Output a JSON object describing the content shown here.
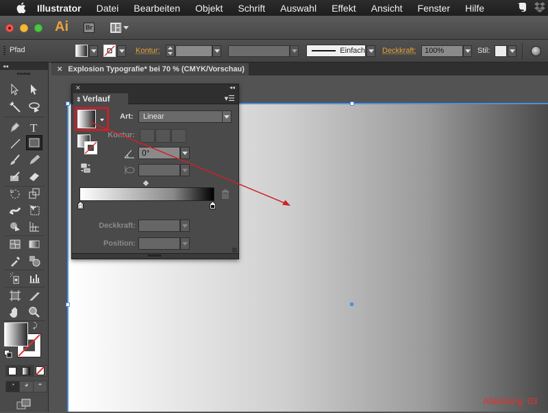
{
  "menubar": {
    "app_name": "Illustrator",
    "items": [
      "Datei",
      "Bearbeiten",
      "Objekt",
      "Schrift",
      "Auswahl",
      "Effekt",
      "Ansicht",
      "Fenster",
      "Hilfe"
    ],
    "tray_icons": [
      "evernote-icon",
      "dropbox-icon"
    ]
  },
  "appbar": {
    "logo": "Ai",
    "bridge_label": "Br"
  },
  "control_bar": {
    "selection_type": "Pfad",
    "stroke_label": "Kontur:",
    "stroke_weight_value": "",
    "stroke_profile_value": "Einfach",
    "opacity_label": "Deckkraft:",
    "opacity_value": "100%",
    "style_label": "Stil:"
  },
  "document_tab": {
    "title": "Explosion Typografie* bei 70 % (CMYK/Vorschau)"
  },
  "gradient_panel": {
    "title": "Verlauf",
    "type_label": "Art:",
    "type_value": "Linear",
    "stroke_label": "Kontur:",
    "angle_value": "0°",
    "aspect_value": "",
    "opacity_label": "Deckkraft:",
    "opacity_value": "",
    "position_label": "Position:",
    "position_value": "",
    "stops": [
      {
        "color": "#ffffff",
        "location_percent": 0
      },
      {
        "color": "#000000",
        "location_percent": 100
      }
    ],
    "midpoint_percent": 50
  },
  "colors": {
    "accent_orange": "#e8a43c",
    "selection_blue": "#4a90e2",
    "annotation_red": "#d0202a"
  },
  "figure_label": "Abbildung: 03"
}
